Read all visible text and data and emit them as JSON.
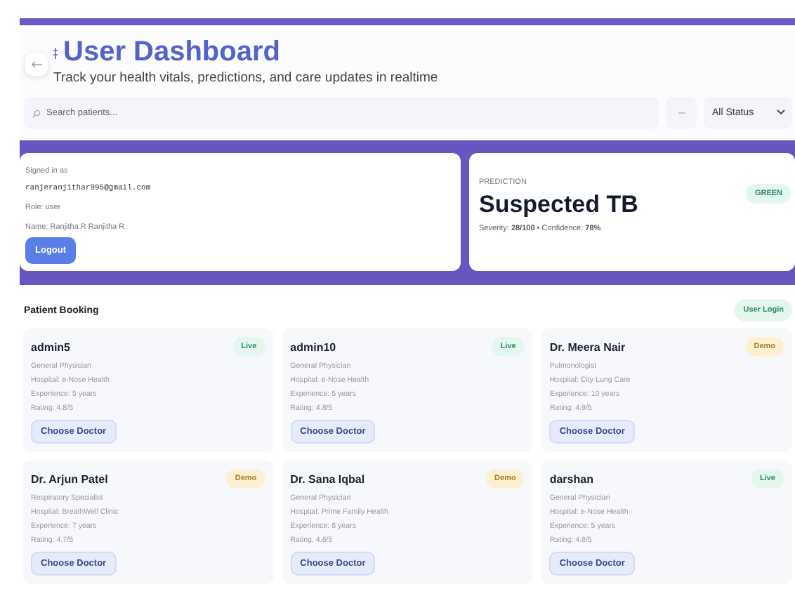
{
  "header": {
    "title": "User Dashboard",
    "subtitle": "Track your health vitals, predictions, and care updates in realtime"
  },
  "search": {
    "placeholder": "Search patients..."
  },
  "status_filter": {
    "value": "All Status"
  },
  "account": {
    "label": "Signed in as",
    "email": "ranjeranjithar995@gmail.com",
    "role": "Role: user",
    "name": "Name: Ranjitha R Ranjitha R",
    "logout": "Logout"
  },
  "prediction": {
    "label": "PREDICTION",
    "result": "Suspected TB",
    "details": "Severity: **28/100** • Confidence: **78%**",
    "badge": "GREEN"
  },
  "booking": {
    "title": "Patient Booking",
    "login": "User Login",
    "doctors": [
      {
        "name": "admin5",
        "specialty": "General Physician",
        "hospital": "Hospital: e-Nose Health",
        "experience": "Experience: 5 years",
        "rating": "Rating: 4.8/5",
        "badge": "Live",
        "kind": "live",
        "action": "Choose Doctor"
      },
      {
        "name": "admin10",
        "specialty": "General Physician",
        "hospital": "Hospital: e-Nose Health",
        "experience": "Experience: 5 years",
        "rating": "Rating: 4.8/5",
        "badge": "Live",
        "kind": "live",
        "action": "Choose Doctor"
      },
      {
        "name": "Dr. Meera Nair",
        "specialty": "Pulmonologist",
        "hospital": "Hospital: City Lung Care",
        "experience": "Experience: 10 years",
        "rating": "Rating: 4.9/5",
        "badge": "Demo",
        "kind": "demo",
        "action": "Choose Doctor"
      },
      {
        "name": "Dr. Arjun Patel",
        "specialty": "Respiratory Specialist",
        "hospital": "Hospital: BreathWell Clinic",
        "experience": "Experience: 7 years",
        "rating": "Rating: 4.7/5",
        "badge": "Demo",
        "kind": "demo",
        "action": "Choose Doctor"
      },
      {
        "name": "Dr. Sana Iqbal",
        "specialty": "General Physician",
        "hospital": "Hospital: Prime Family Health",
        "experience": "Experience: 8 years",
        "rating": "Rating: 4.6/5",
        "badge": "Demo",
        "kind": "demo",
        "action": "Choose Doctor"
      },
      {
        "name": "darshan",
        "specialty": "General Physician",
        "hospital": "Hospital: e-Nose Health",
        "experience": "Experience: 5 years",
        "rating": "Rating: 4.8/5",
        "badge": "Live",
        "kind": "live",
        "action": "Choose Doctor"
      }
    ]
  }
}
